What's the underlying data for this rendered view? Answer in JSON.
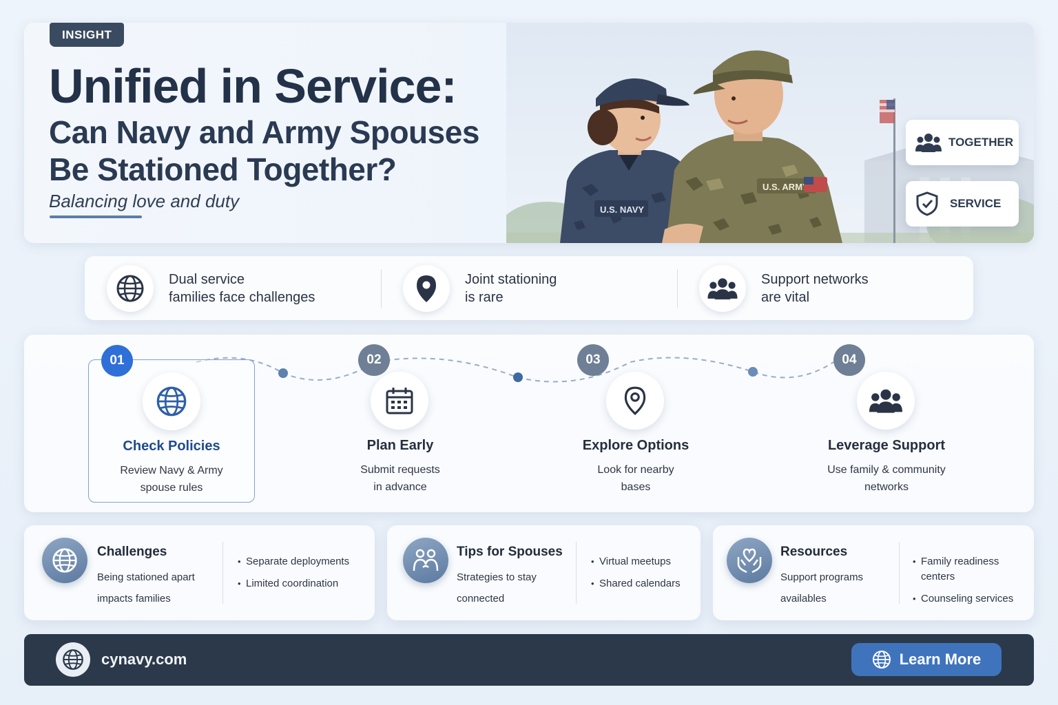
{
  "hero": {
    "badge": "INSIGHT",
    "title": "Unified in Service:",
    "subtitle_line1": "Can Navy and Army Spouses",
    "subtitle_line2": "Be Stationed Together?",
    "tagline": "Balancing love and duty",
    "navy_patch": "U.S. NAVY",
    "army_patch": "U.S. ARMY",
    "pills": [
      {
        "label": "TOGETHER",
        "icon": "people-icon"
      },
      {
        "label": "SERVICE",
        "icon": "shield-icon"
      }
    ]
  },
  "facts": [
    {
      "line1": "Dual service",
      "line2": "families face challenges",
      "icon": "globe-icon"
    },
    {
      "line1": "Joint stationing",
      "line2": "is rare",
      "icon": "map-pin-icon"
    },
    {
      "line1": "Support networks",
      "line2": "are vital",
      "icon": "people-icon"
    }
  ],
  "steps": [
    {
      "num": "01",
      "title": "Check Policies",
      "desc1": "Review Navy & Army",
      "desc2": "spouse rules",
      "icon": "globe-icon"
    },
    {
      "num": "02",
      "title": "Plan Early",
      "desc1": "Submit requests",
      "desc2": "in advance",
      "icon": "calendar-icon"
    },
    {
      "num": "03",
      "title": "Explore Options",
      "desc1": "Look for nearby",
      "desc2": "bases",
      "icon": "map-pin-icon"
    },
    {
      "num": "04",
      "title": "Leverage Support",
      "desc1": "Use family & community",
      "desc2": "networks",
      "icon": "people-icon"
    }
  ],
  "info": [
    {
      "title": "Challenges",
      "desc1": "Being stationed apart",
      "desc2": "impacts families",
      "items": [
        "Separate deployments",
        "Limited coordination"
      ],
      "icon": "globe-icon"
    },
    {
      "title": "Tips for Spouses",
      "desc1": "Strategies to stay",
      "desc2": "connected",
      "items": [
        "Virtual meetups",
        "Shared calendars"
      ],
      "icon": "couple-icon"
    },
    {
      "title": "Resources",
      "desc1": "Support programs",
      "desc2": "availables",
      "items": [
        "Family readiness centers",
        "Counseling services"
      ],
      "icon": "heart-hands-icon"
    }
  ],
  "footer": {
    "site": "cynavy.com",
    "button": "Learn More"
  },
  "colors": {
    "accent": "#2f6fd8",
    "dark": "#2c394a",
    "button": "#3f74bd"
  }
}
